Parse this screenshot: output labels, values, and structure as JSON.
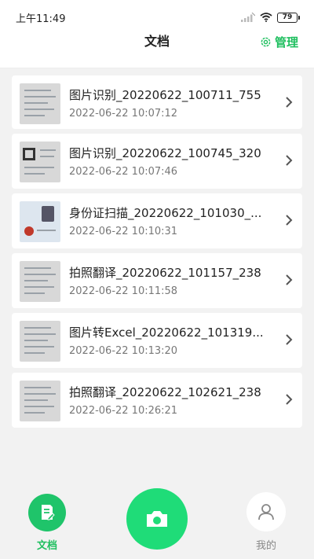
{
  "status_bar": {
    "time": "上午11:49",
    "battery": "79"
  },
  "header": {
    "title": "文档",
    "manage_label": "管理"
  },
  "documents": [
    {
      "name": "图片识别_20220622_100711_755",
      "date": "2022-06-22 10:07:12",
      "thumb": "document"
    },
    {
      "name": "图片识别_20220622_100745_320",
      "date": "2022-06-22 10:07:46",
      "thumb": "qr-document"
    },
    {
      "name": "身份证扫描_20220622_101030_...",
      "date": "2022-06-22 10:10:31",
      "thumb": "id-card"
    },
    {
      "name": "拍照翻译_20220622_101157_238",
      "date": "2022-06-22 10:11:58",
      "thumb": "document"
    },
    {
      "name": "图片转Excel_20220622_101319...",
      "date": "2022-06-22 10:13:20",
      "thumb": "document"
    },
    {
      "name": "拍照翻译_20220622_102621_238",
      "date": "2022-06-22 10:26:21",
      "thumb": "document"
    }
  ],
  "tabbar": {
    "docs_label": "文档",
    "mine_label": "我的"
  },
  "colors": {
    "accent": "#1fbf5f",
    "camera": "#1fdc78"
  }
}
